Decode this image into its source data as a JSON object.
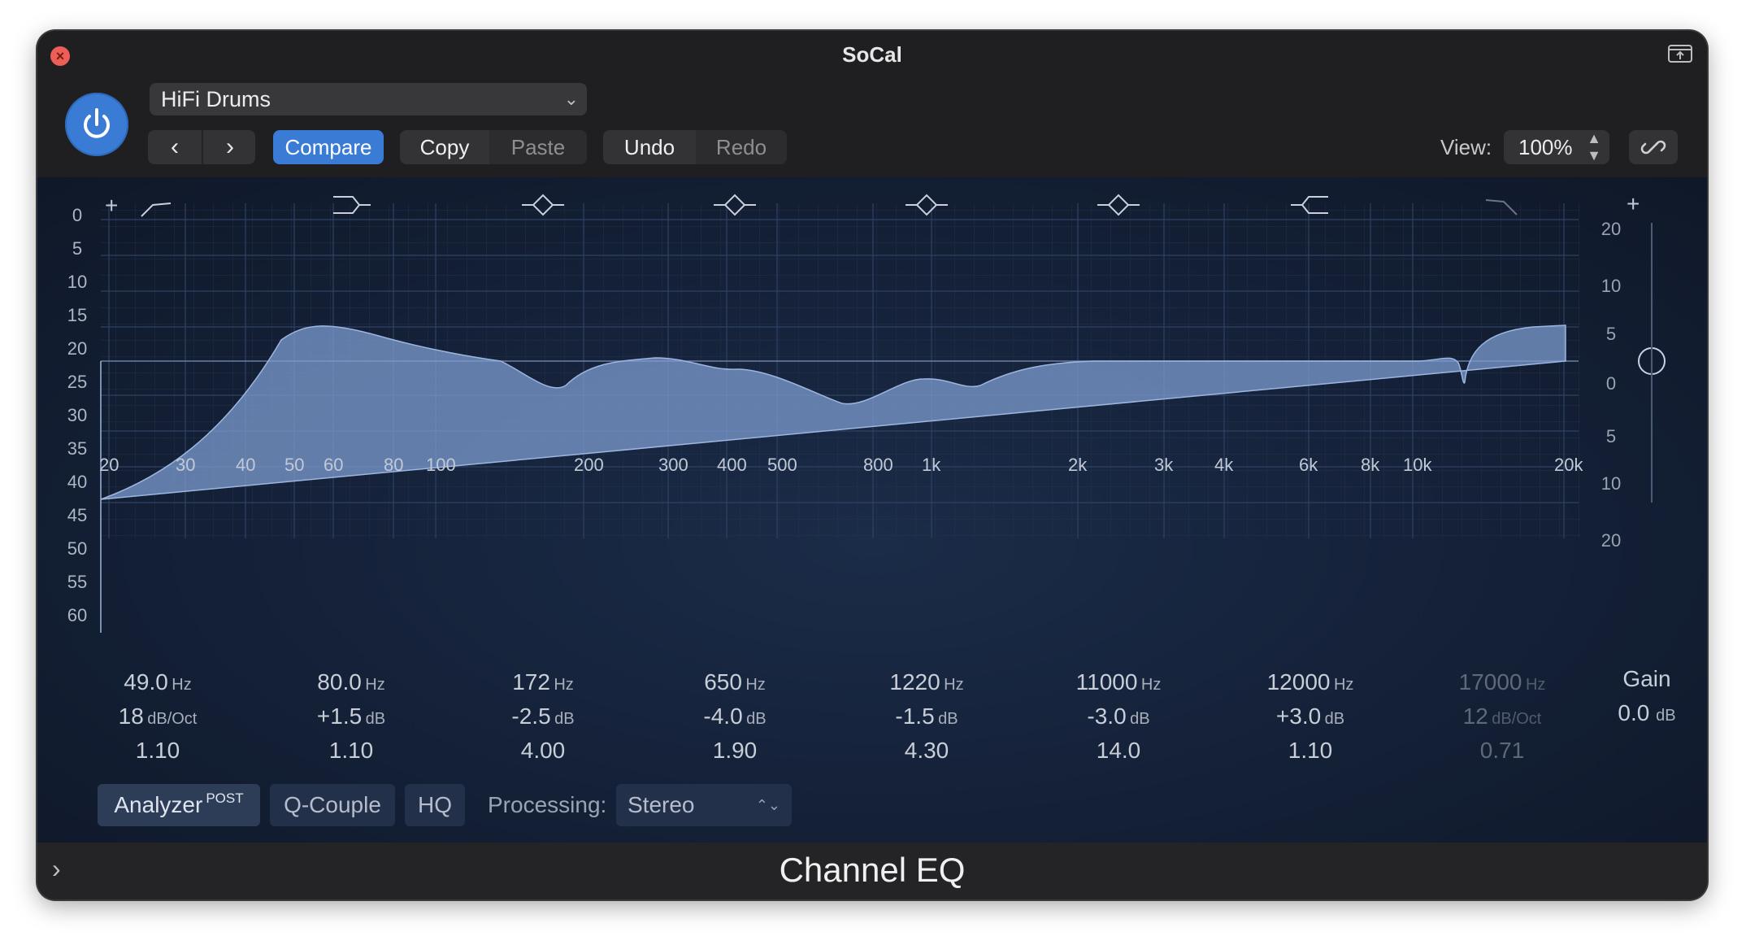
{
  "window": {
    "title": "SoCal"
  },
  "toolbar": {
    "preset": "HiFi Drums",
    "compare": "Compare",
    "copy": "Copy",
    "paste": "Paste",
    "undo": "Undo",
    "redo": "Redo",
    "view_label": "View:",
    "view_value": "100%"
  },
  "scale_left": [
    "0",
    "5",
    "10",
    "15",
    "20",
    "25",
    "30",
    "35",
    "40",
    "45",
    "50",
    "55",
    "60"
  ],
  "scale_right": [
    "20",
    "10",
    "5",
    "0",
    "5",
    "10",
    "20"
  ],
  "freq_labels": [
    "20",
    "30",
    "40",
    "50",
    "60",
    "80",
    "100",
    "200",
    "300",
    "400",
    "500",
    "800",
    "1k",
    "2k",
    "3k",
    "4k",
    "6k",
    "8k",
    "10k",
    "20k"
  ],
  "bands": [
    {
      "freq": "49.0",
      "freq_unit": "Hz",
      "second": "18",
      "second_unit": "dB/Oct",
      "q": "1.10",
      "type": "low-cut"
    },
    {
      "freq": "80.0",
      "freq_unit": "Hz",
      "second": "+1.5",
      "second_unit": "dB",
      "q": "1.10",
      "type": "low-shelf"
    },
    {
      "freq": "172",
      "freq_unit": "Hz",
      "second": "-2.5",
      "second_unit": "dB",
      "q": "4.00",
      "type": "bell"
    },
    {
      "freq": "650",
      "freq_unit": "Hz",
      "second": "-4.0",
      "second_unit": "dB",
      "q": "1.90",
      "type": "bell"
    },
    {
      "freq": "1220",
      "freq_unit": "Hz",
      "second": "-1.5",
      "second_unit": "dB",
      "q": "4.30",
      "type": "bell"
    },
    {
      "freq": "11000",
      "freq_unit": "Hz",
      "second": "-3.0",
      "second_unit": "dB",
      "q": "14.0",
      "type": "bell"
    },
    {
      "freq": "12000",
      "freq_unit": "Hz",
      "second": "+3.0",
      "second_unit": "dB",
      "q": "1.10",
      "type": "high-shelf"
    },
    {
      "freq": "17000",
      "freq_unit": "Hz",
      "second": "12",
      "second_unit": "dB/Oct",
      "q": "0.71",
      "type": "high-cut",
      "disabled": true
    }
  ],
  "gain": {
    "label": "Gain",
    "value": "0.0",
    "unit": "dB"
  },
  "bottom": {
    "analyzer": "Analyzer",
    "analyzer_mode": "POST",
    "qcouple": "Q-Couple",
    "hq": "HQ",
    "processing_label": "Processing:",
    "processing_value": "Stereo"
  },
  "footer": {
    "plugin_name": "Channel EQ"
  },
  "colors": {
    "accent": "#3a7bd5",
    "curve_fill": "#7d9cd0",
    "close": "#ec5f57"
  }
}
